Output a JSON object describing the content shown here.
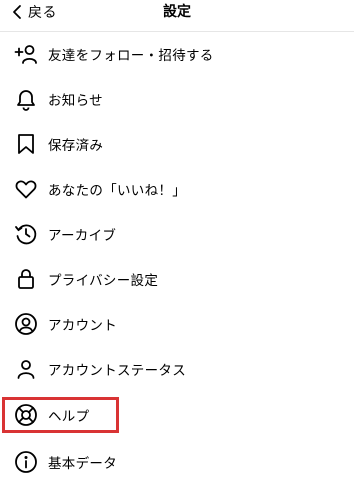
{
  "header": {
    "back_label": "戻る",
    "title": "設定"
  },
  "menu": [
    {
      "label": "友達をフォロー・招待する",
      "icon": "add-person-icon"
    },
    {
      "label": "お知らせ",
      "icon": "bell-icon"
    },
    {
      "label": "保存済み",
      "icon": "bookmark-icon"
    },
    {
      "label": "あなたの「いいね！」",
      "icon": "heart-icon"
    },
    {
      "label": "アーカイブ",
      "icon": "archive-clock-icon"
    },
    {
      "label": "プライバシー設定",
      "icon": "lock-icon"
    },
    {
      "label": "アカウント",
      "icon": "account-circle-icon"
    },
    {
      "label": "アカウントステータス",
      "icon": "person-icon"
    },
    {
      "label": "ヘルプ",
      "icon": "lifebuoy-icon"
    },
    {
      "label": "基本データ",
      "icon": "info-icon"
    }
  ],
  "highlight_color": "#d93334"
}
